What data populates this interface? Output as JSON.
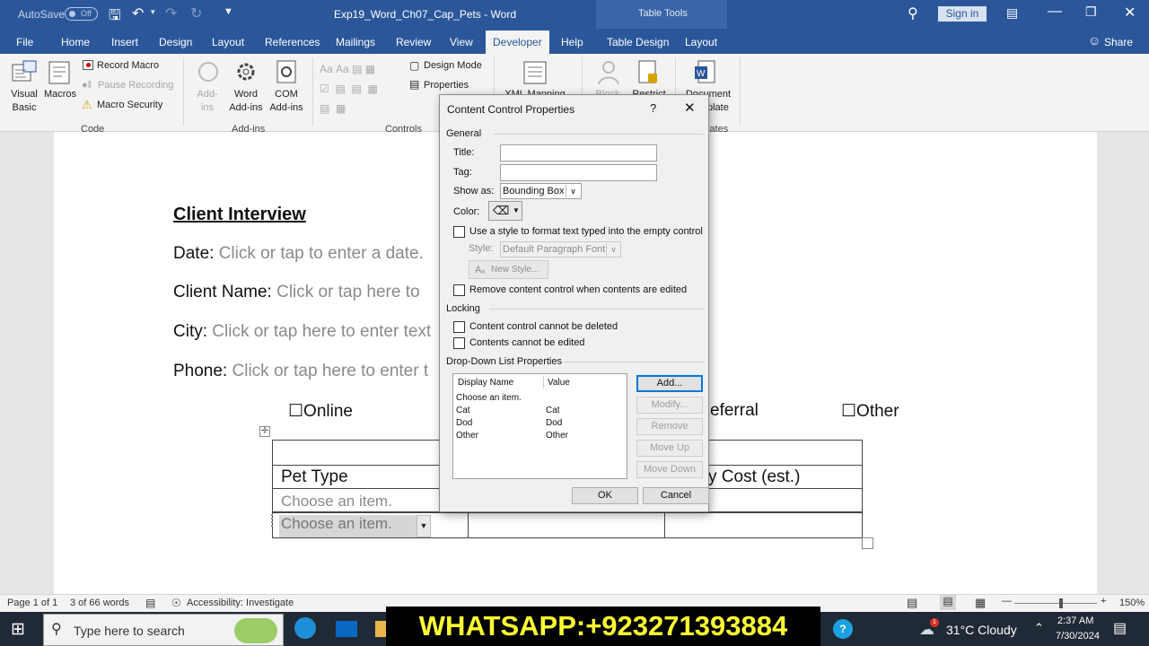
{
  "titlebar": {
    "autosave_label": "AutoSave",
    "autosave_state": "Off",
    "doc_title": "Exp19_Word_Ch07_Cap_Pets - Word",
    "table_tools": "Table Tools",
    "sign_in": "Sign in"
  },
  "menu": {
    "items": [
      "File",
      "Home",
      "Insert",
      "Design",
      "Layout",
      "References",
      "Mailings",
      "Review",
      "View",
      "Developer",
      "Help",
      "Table Design",
      "Layout"
    ],
    "active": "Developer",
    "share": "Share"
  },
  "ribbon": {
    "visual_basic": "Visual\nBasic",
    "macros": "Macros",
    "record_macro": "Record Macro",
    "pause_recording": "Pause Recording",
    "macro_security": "Macro Security",
    "group_code": "Code",
    "addins": "Add-\nins",
    "word_addins": "Word\nAdd-ins",
    "com_addins": "COM\nAdd-ins",
    "group_addins": "Add-ins",
    "design_mode": "Design Mode",
    "properties": "Properties",
    "group_controls": "Controls",
    "xml_mapping": "XML Mapping",
    "block": "Block",
    "restrict": "Restrict",
    "document": "Document",
    "plate": "plate",
    "group_templates": "lates"
  },
  "document": {
    "heading": "Client Interview",
    "date_label": "Date:",
    "date_ph": "Click or tap to enter a date.",
    "name_label": "Client Name:",
    "name_ph": "Click or tap here to",
    "city_label": "City:",
    "city_ph": "Click or tap here to enter text",
    "phone_label": "Phone:",
    "phone_ph": "Click or tap here to enter t",
    "online": "Online",
    "referral": "eferral",
    "other": "Other",
    "pet_type": "Pet Type",
    "cost": "y Cost (est.)",
    "choose1": "Choose an item.",
    "choose2": "Choose an item."
  },
  "dialog": {
    "title": "Content Control Properties",
    "help": "?",
    "general": "General",
    "title_label": "Title:",
    "title_value": "",
    "tag_label": "Tag:",
    "tag_value": "",
    "show_as_label": "Show as:",
    "show_as_value": "Bounding Box",
    "color_label": "Color:",
    "use_style": "Use a style to format text typed into the empty control",
    "style_label": "Style:",
    "style_value": "Default Paragraph Font",
    "new_style": "New Style...",
    "remove_cc": "Remove content control when contents are edited",
    "locking": "Locking",
    "cannot_delete": "Content control cannot be deleted",
    "cannot_edit": "Contents cannot be edited",
    "ddl_props": "Drop-Down List Properties",
    "col_display": "Display Name",
    "col_value": "Value",
    "items": [
      {
        "display": "Choose an item.",
        "value": ""
      },
      {
        "display": "Cat",
        "value": "Cat"
      },
      {
        "display": "Dod",
        "value": "Dod"
      },
      {
        "display": "Other",
        "value": "Other"
      }
    ],
    "btn_add": "Add...",
    "btn_modify": "Modify...",
    "btn_remove": "Remove",
    "btn_moveup": "Move Up",
    "btn_movedown": "Move Down",
    "btn_ok": "OK",
    "btn_cancel": "Cancel"
  },
  "statusbar": {
    "page": "Page 1 of 1",
    "words": "3 of 66 words",
    "accessibility": "Accessibility: Investigate",
    "zoom": "150%"
  },
  "taskbar": {
    "search_ph": "Type here to search",
    "whatsapp": "WHATSAPP:+923271393884",
    "weather": "31°C  Cloudy",
    "time": "2:37 AM",
    "date": "7/30/2024",
    "badge": "1"
  }
}
